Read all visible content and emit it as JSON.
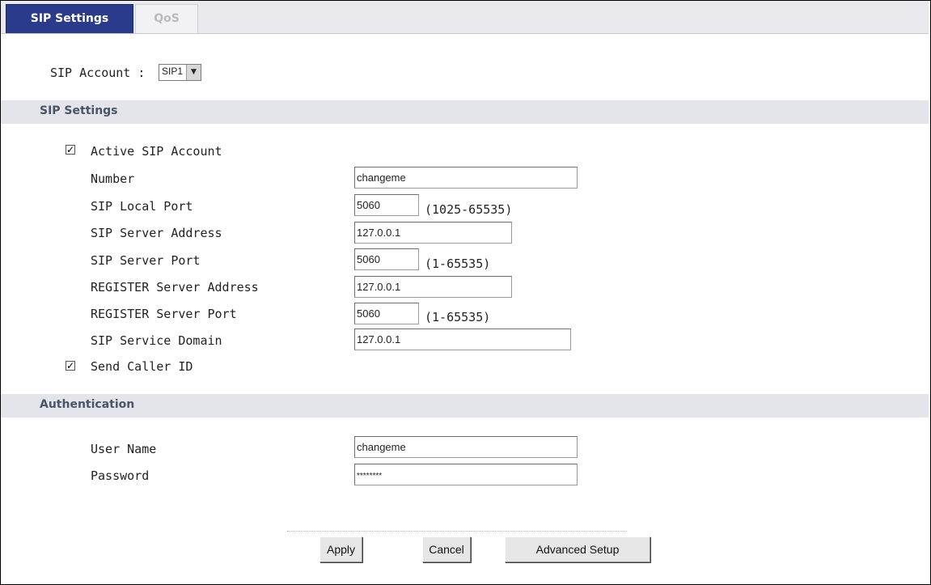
{
  "tabs": {
    "sip_settings": "SIP Settings",
    "qos": "QoS"
  },
  "account": {
    "label": "SIP Account :",
    "selected": "SIP1"
  },
  "section_sip": {
    "title": "SIP Settings"
  },
  "active_sip_account": {
    "label": "Active SIP Account",
    "checked": true
  },
  "fields": {
    "number": {
      "label": "Number",
      "value": "changeme"
    },
    "sip_local_port": {
      "label": "SIP Local Port",
      "value": "5060",
      "range": "(1025-65535)"
    },
    "sip_server_address": {
      "label": "SIP Server Address",
      "value": "127.0.0.1"
    },
    "sip_server_port": {
      "label": "SIP Server Port",
      "value": "5060",
      "range": "(1-65535)"
    },
    "register_server_address": {
      "label": "REGISTER Server Address",
      "value": "127.0.0.1"
    },
    "register_server_port": {
      "label": "REGISTER Server Port",
      "value": "5060",
      "range": "(1-65535)"
    },
    "sip_service_domain": {
      "label": "SIP Service Domain",
      "value": "127.0.0.1"
    }
  },
  "send_caller_id": {
    "label": "Send Caller ID",
    "checked": true
  },
  "section_auth": {
    "title": "Authentication"
  },
  "auth": {
    "user_name": {
      "label": "User Name",
      "value": "changeme"
    },
    "password": {
      "label": "Password",
      "value": "********"
    }
  },
  "buttons": {
    "apply": "Apply",
    "cancel": "Cancel",
    "advanced": "Advanced Setup"
  },
  "colors": {
    "tab_active_bg": "#2b3b8b",
    "section_bg": "#e3e5ea",
    "section_text": "#4a5466"
  }
}
